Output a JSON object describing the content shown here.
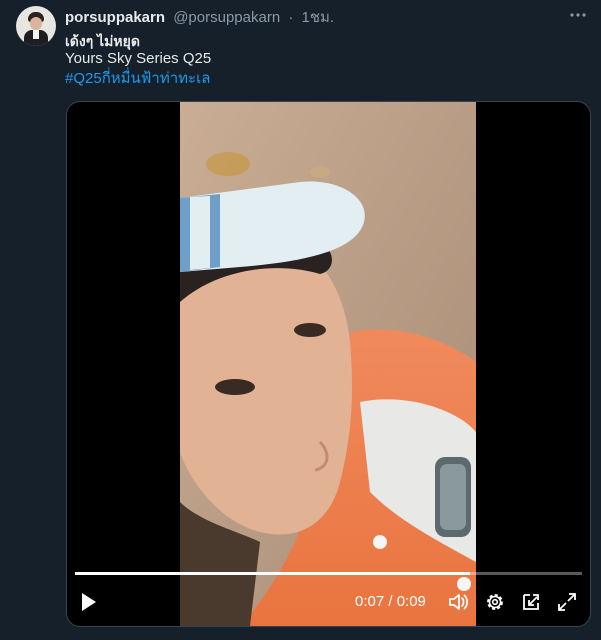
{
  "tweet": {
    "display_name": "porsuppakarn",
    "handle": "@porsuppakarn",
    "separator": "·",
    "time": "1ชม.",
    "more_icon": "more-horizontal-icon",
    "lines": [
      "เด้งๆ ไม่หยุด",
      "Yours Sky Series Q25",
      "#Q25กี่หมื่นฟ้าท่าทะเล"
    ],
    "hashtag_color": "#1d9bf0"
  },
  "video": {
    "current_time": "0:07",
    "duration": "0:09",
    "timecode": "0:07 / 0:09",
    "progress": 0.78,
    "controls": [
      "play-icon",
      "volume-icon",
      "settings-icon",
      "picture-in-picture-icon",
      "fullscreen-icon"
    ]
  },
  "colors": {
    "background": "#15202b",
    "text": "#e7e9ea",
    "secondary": "#8b98a5",
    "accent": "#1d9bf0",
    "border": "#38444d"
  }
}
